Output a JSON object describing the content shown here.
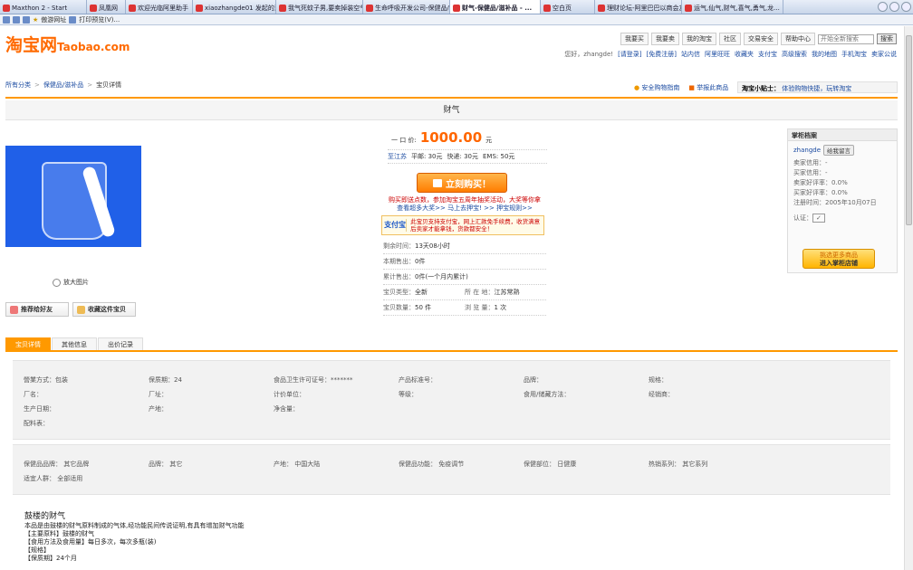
{
  "browser": {
    "tabs": [
      {
        "label": "Maxthon 2 - Start",
        "active": false
      },
      {
        "label": "凤凰网",
        "active": false
      },
      {
        "label": "欢迎光临阿里助手",
        "active": false
      },
      {
        "label": "xiaozhangde01 发起的活...",
        "active": false
      },
      {
        "label": "我气死蚊子男,要卖掉装空气...",
        "active": false
      },
      {
        "label": "生命呼吸开发公司-保健品/...",
        "active": false
      },
      {
        "label": "财气-保健品/滋补品 - ...",
        "active": true
      },
      {
        "label": "空白页",
        "active": false
      },
      {
        "label": "理财论坛-阿里巴巴以商会友",
        "active": false
      },
      {
        "label": "运气,仙气,财气,喜气,勇气,龙...",
        "active": false
      }
    ],
    "favorites": [
      "傲游网址",
      "打印预览(V)..."
    ]
  },
  "header": {
    "logo": "淘宝网",
    "logo_en": "Taobao.com",
    "nav": [
      "我要买",
      "我要卖",
      "我的淘宝",
      "社区",
      "交易安全",
      "帮助中心"
    ],
    "search_placeholder": "开始全新搜索",
    "search_button": "搜索",
    "greeting": "您好，zhangde!",
    "user_links": [
      "[请登录]",
      "[免费注册]",
      "站内信",
      "阿里旺旺",
      "收藏夹",
      "支付宝",
      "高级搜索",
      "我的地图",
      "手机淘宝",
      "卖家公说"
    ]
  },
  "breadcrumb": [
    "所有分类",
    "保健品/滋补品",
    "宝贝详情"
  ],
  "safety_links": [
    "安全购物指南",
    "举报此商品"
  ],
  "tip": {
    "label": "淘宝小贴士：",
    "text": "体验购物快捷，玩转淘宝"
  },
  "product": {
    "title": "财气",
    "price_label": "一 口 价:",
    "price": "1000.00",
    "price_unit": "元",
    "location": "至江苏",
    "shipping": [
      "平邮: 30元",
      "快递: 30元",
      "EMS: 50元"
    ],
    "zoom_label": "放大图片",
    "recommend_button": "推荐给好友",
    "favorite_button": "收藏这件宝贝",
    "buy_button": "立刻购买！",
    "promo_line1": "购买即送点数，参加淘宝五周年抽奖活动，大奖等你拿",
    "promo_line2": "查看超多大奖>>   马上去押宝! >>   押宝规则>>",
    "alipay_logo": "支付宝",
    "alipay_text": "此宝贝支持支付宝，网上汇款免手续费，收货满意后卖家才能拿钱，货款都安全！",
    "info": [
      {
        "k": "剩余时间：",
        "v": "13天08小时"
      },
      {
        "k": "本期售出：",
        "v": "0件"
      },
      {
        "k": "累计售出：",
        "v": "0件(一个月内累计)"
      }
    ],
    "info2": [
      [
        {
          "k": "宝贝类型：",
          "v": "全新"
        },
        {
          "k": "所 在 地：",
          "v": "江苏常熟"
        }
      ],
      [
        {
          "k": "宝贝数量：",
          "v": "50 件"
        },
        {
          "k": "浏 览 量：",
          "v": "1 次"
        }
      ]
    ]
  },
  "seller": {
    "title": "掌柜档案",
    "name": "zhangde",
    "msg_button": "给我留言",
    "lines": [
      "卖家信用：-",
      "买家信用：-",
      "卖家好评率：0.0%",
      "买家好评率：0.0%",
      "注册时间：2005年10月07日"
    ],
    "cert_label": "认证：",
    "shop_button_l1": "挑选更多商品",
    "shop_button_l2": "进入掌柜店铺"
  },
  "detail_tabs": [
    "宝贝详情",
    "其他信息",
    "出价记录"
  ],
  "attributes": [
    "營業方式：包装",
    "保质期：24",
    "食品卫生许可证号：*******",
    "产品标准号：",
    "品牌：",
    "规格：",
    "厂名：",
    "厂址：",
    "计价单位：",
    "等级：",
    "食用/储藏方法：",
    "经销商：",
    "生产日期：",
    "产地：",
    "净含量：",
    "",
    "",
    "",
    "配料表：",
    "",
    "",
    "",
    "",
    ""
  ],
  "attributes2": [
    "保健品品牌： 其它品牌",
    "品牌： 其它",
    "产地： 中国大陆",
    "保健品功能： 免疫调节",
    "保健部位： 日健康",
    "热销系列： 其它系列",
    "适宜人群： 全部适用",
    "",
    "",
    "",
    "",
    ""
  ],
  "description": {
    "title": "鼓楼的财气",
    "lines": [
      "本品是由鼓楼的财气原料制成的气体,经功能民间传说证明,有具有增加财气功能",
      "【主要原料】鼓楼的财气",
      "【食用方法及食用量】每日多次，每次多瓶(装)",
      "【规格】",
      "【保质期】24个月"
    ]
  }
}
